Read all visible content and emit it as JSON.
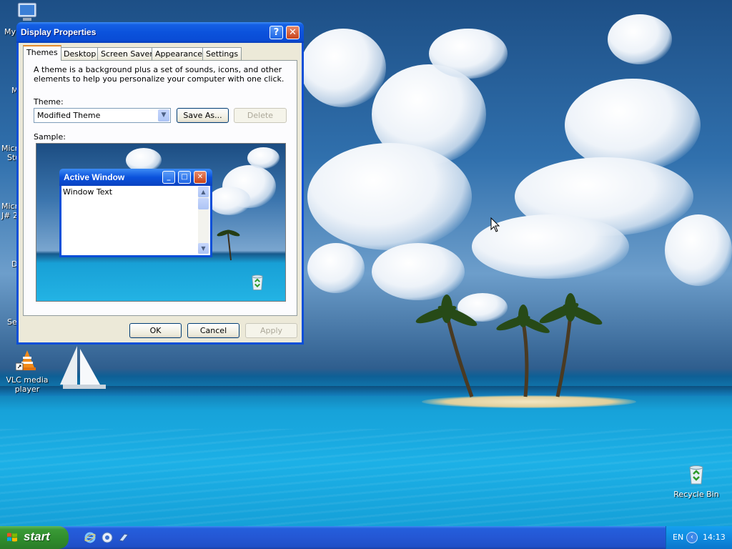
{
  "desktop": {
    "icons": [
      {
        "name": "vlc",
        "label": "VLC media player"
      },
      {
        "name": "recycle-bin",
        "label": "Recycle Bin"
      }
    ],
    "partial_labels": [
      "My",
      "M",
      "Micr",
      "Stu",
      "Micr",
      "J# 2",
      "D",
      "Se"
    ]
  },
  "dialog": {
    "title": "Display Properties",
    "tabs": [
      "Themes",
      "Desktop",
      "Screen Saver",
      "Appearance",
      "Settings"
    ],
    "active_tab": "Themes",
    "description": "A theme is a background plus a set of sounds, icons, and other elements to help you personalize your computer with one click.",
    "theme_label": "Theme:",
    "theme_value": "Modified Theme",
    "save_as_label": "Save As...",
    "delete_label": "Delete",
    "sample_label": "Sample:",
    "preview": {
      "window_title": "Active Window",
      "window_text": "Window Text"
    },
    "ok_label": "OK",
    "cancel_label": "Cancel",
    "apply_label": "Apply"
  },
  "taskbar": {
    "start_label": "start",
    "language": "EN",
    "clock": "14:13",
    "quick_launch": [
      "internet-explorer-icon",
      "media-player-icon",
      "launch-icon"
    ]
  },
  "colors": {
    "titlebar": "#0b52dc",
    "dialog_face": "#ece9d8",
    "start_green": "#3a9a36",
    "taskbar_blue": "#245edc"
  }
}
